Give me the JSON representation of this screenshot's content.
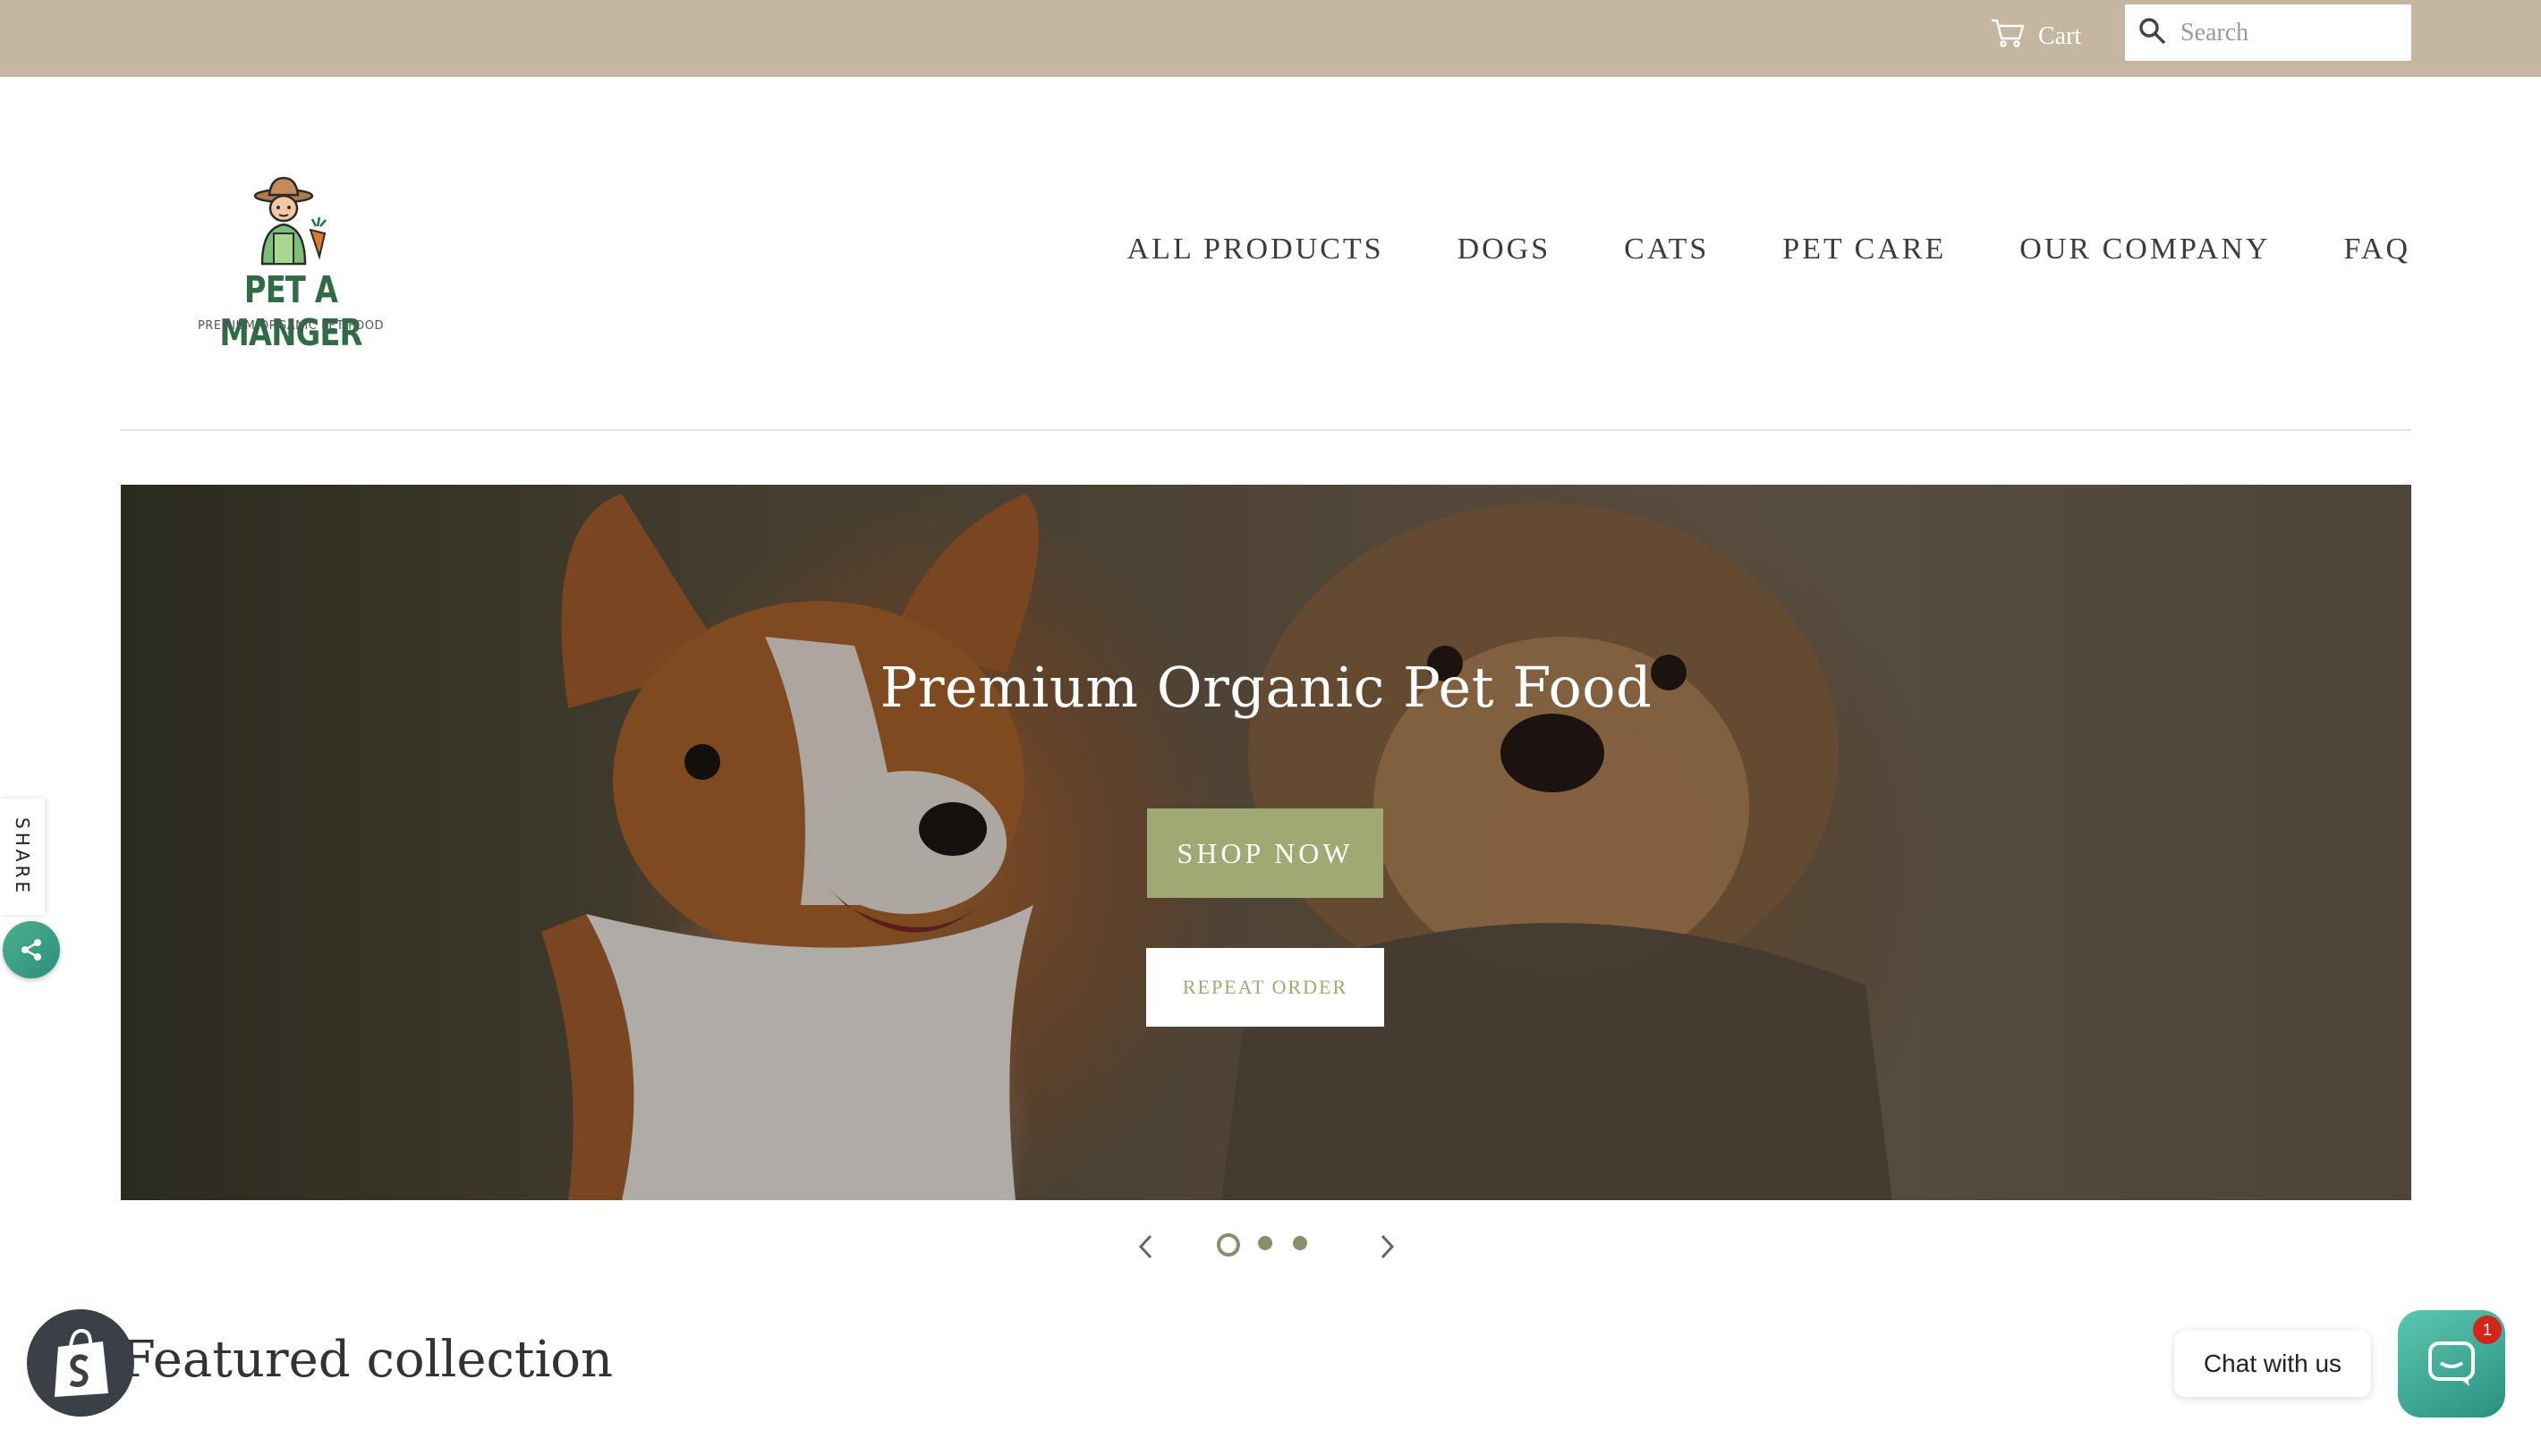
{
  "topbar": {
    "cart_label": "Cart",
    "search_placeholder": "Search"
  },
  "logo": {
    "title": "PET A MANGER",
    "subtitle": "PREMIUM ORGANIC PET FOOD"
  },
  "nav": {
    "items": [
      "ALL PRODUCTS",
      "DOGS",
      "CATS",
      "PET CARE",
      "OUR COMPANY",
      "FAQ"
    ]
  },
  "hero": {
    "title": "Premium Organic Pet Food",
    "shop_button": "SHOP NOW",
    "repeat_button": "REPEAT ORDER"
  },
  "slider": {
    "total_slides": 3,
    "active_slide": 1
  },
  "share": {
    "label": "SHARE"
  },
  "featured": {
    "title": "Featured collection"
  },
  "chat": {
    "label": "Chat with us",
    "badge_count": "1"
  },
  "colors": {
    "topbar": "#c5b79f",
    "accent": "#a0a874",
    "logo_green": "#2f6b44",
    "chat_teal": "#3aa791"
  }
}
